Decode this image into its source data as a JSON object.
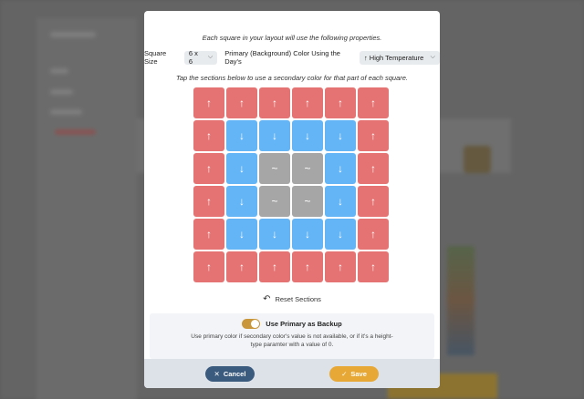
{
  "modal": {
    "intro": "Each square in your layout will use the following properties.",
    "size_label": "Square Size",
    "size_value": "6 x 6",
    "primary_label": "Primary (Background) Color Using the Day's",
    "primary_value": "High Temperature",
    "primary_icon": "arrow-up",
    "hint": "Tap the sections below to use a secondary color for that part of each square.",
    "grid": [
      [
        "red",
        "red",
        "red",
        "red",
        "red",
        "red"
      ],
      [
        "red",
        "blue",
        "blue",
        "blue",
        "blue",
        "red"
      ],
      [
        "red",
        "blue",
        "grey",
        "grey",
        "blue",
        "red"
      ],
      [
        "red",
        "blue",
        "grey",
        "grey",
        "blue",
        "red"
      ],
      [
        "red",
        "blue",
        "blue",
        "blue",
        "blue",
        "red"
      ],
      [
        "red",
        "red",
        "red",
        "red",
        "red",
        "red"
      ]
    ],
    "glyphs": {
      "red": "↑",
      "blue": "↓",
      "grey": "~"
    },
    "colors": {
      "red": "#e57373",
      "blue": "#64b5f6",
      "grey": "#a6a6a6"
    },
    "reset_label": "Reset Sections",
    "backup_title": "Use Primary as Backup",
    "backup_on": true,
    "backup_desc": "Use primary color if secondary color's value is not available, or if it's a height-type paramter with a value of 0.",
    "cancel_label": "Cancel",
    "save_label": "Save"
  }
}
